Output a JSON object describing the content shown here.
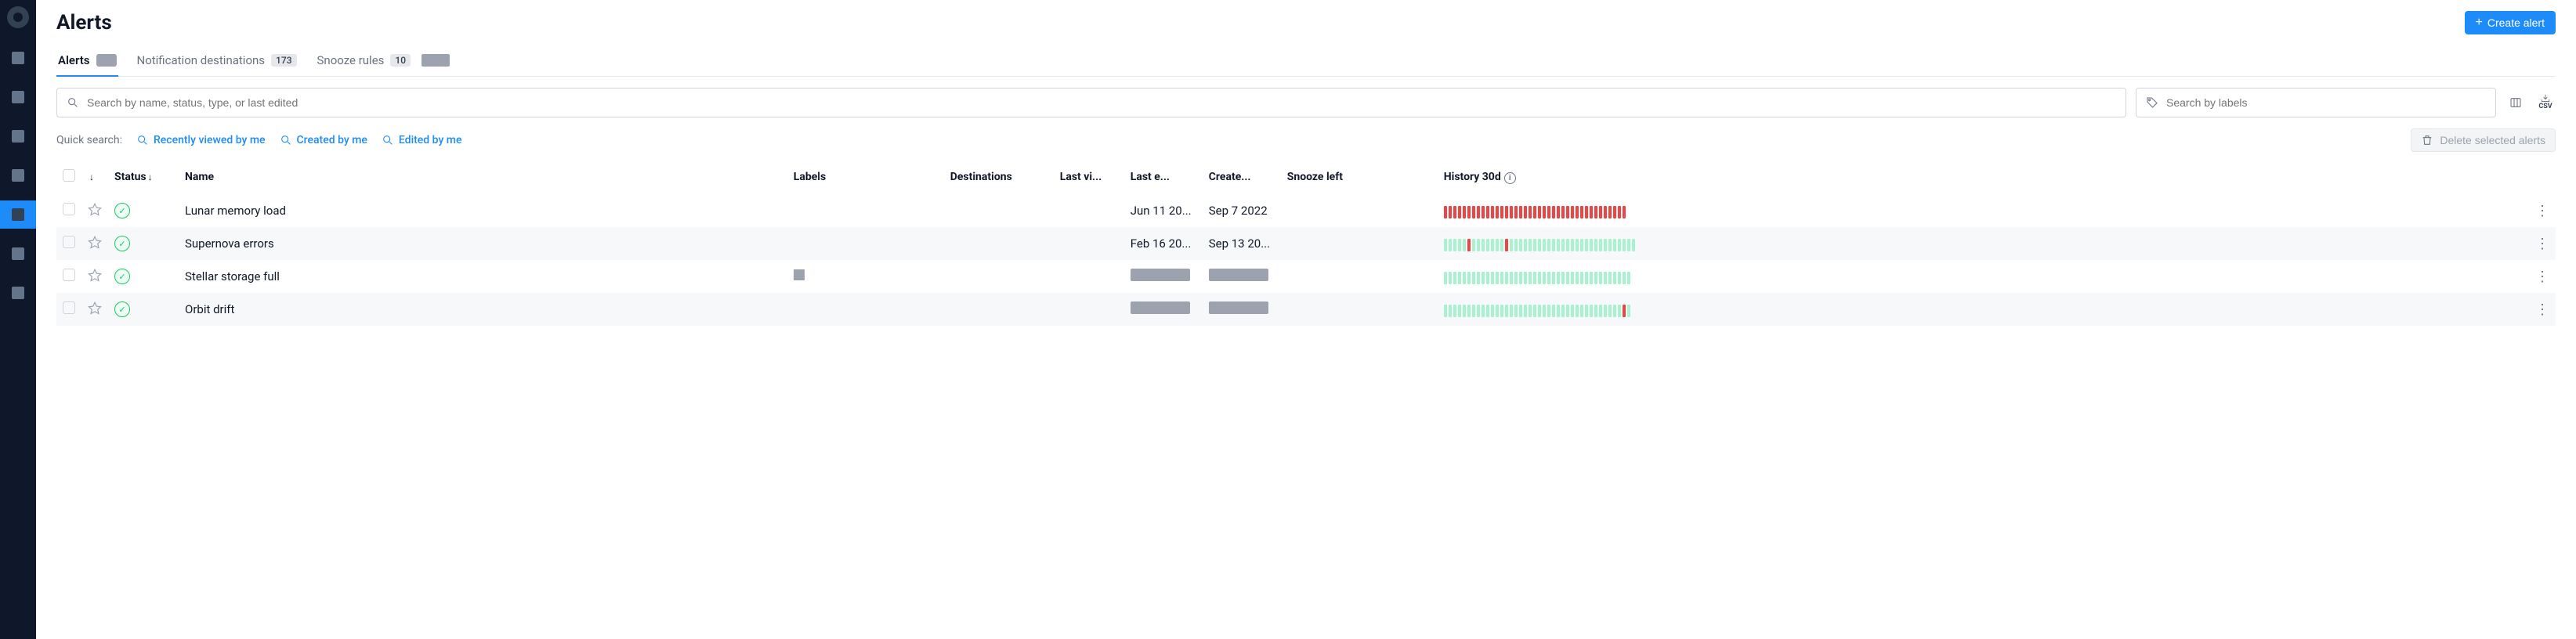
{
  "page_title": "Alerts",
  "create_button": "Create alert",
  "tabs": [
    {
      "label": "Alerts",
      "count": "",
      "redacted": true
    },
    {
      "label": "Notification destinations",
      "count": "173"
    },
    {
      "label": "Snooze rules",
      "count": "10",
      "trailing_redact": true
    }
  ],
  "search": {
    "placeholder": "Search by name, status, type, or last edited"
  },
  "labels_search": {
    "placeholder": "Search by labels"
  },
  "quick": {
    "label": "Quick search:",
    "recent": "Recently viewed by me",
    "created": "Created by me",
    "edited": "Edited by me"
  },
  "delete_btn": "Delete selected alerts",
  "columns": {
    "status": "Status",
    "name": "Name",
    "labels": "Labels",
    "dest": "Destinations",
    "last_vi": "Last vi...",
    "last_e": "Last e...",
    "created": "Create...",
    "snooze": "Snooze left",
    "history": "History 30d"
  },
  "rows": [
    {
      "name": "Lunar memory load",
      "last_e": "Jun 11 20...",
      "created": "Sep 7 2022",
      "spark": "rrrrrrrrrrrrrrrrrrrrrrrrrrrrrrrrrrrrrrr"
    },
    {
      "name": "Supernova errors",
      "last_e": "Feb 16 20...",
      "created": "Sep 13 20...",
      "spark": "gggggrgggggggrggggggggggggggggggggggggggg"
    },
    {
      "name": "Stellar storage full",
      "label_redact": true,
      "last_e_redact": true,
      "created_redact": true,
      "spark": "gggggggggggggggggggggggggggggggggggggggg"
    },
    {
      "name": "Orbit drift",
      "last_e_redact": true,
      "created_redact": true,
      "spark": "ggggggggggggggggggggggggggggggggggggggrg"
    }
  ]
}
